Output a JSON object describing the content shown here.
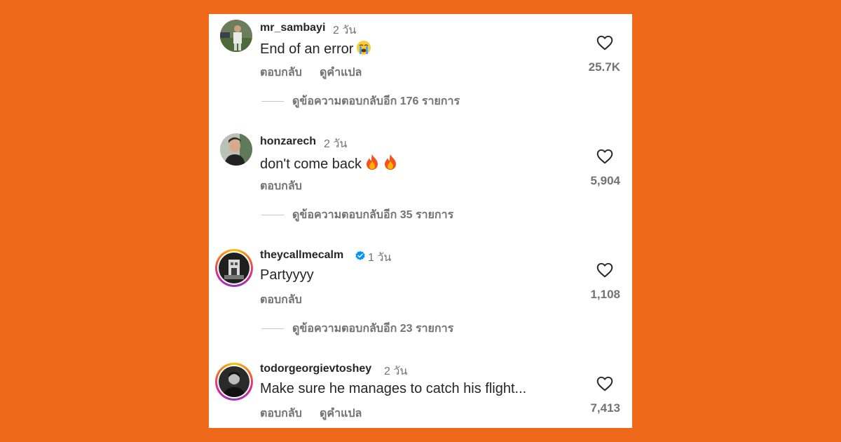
{
  "comments": [
    {
      "username": "mr_sambayi",
      "time": "2 วัน",
      "text": "End of an error",
      "emoji": "crying-face",
      "reply_label": "ตอบกลับ",
      "translate_label": "ดูคำแปล",
      "likes": "25.7K",
      "view_replies": "ดูข้อความตอบกลับอีก 176 รายการ"
    },
    {
      "username": "honzarech",
      "time": "2 วัน",
      "text": "don't come back",
      "emoji": "fire x2",
      "reply_label": "ตอบกลับ",
      "likes": "5,904",
      "view_replies": "ดูข้อความตอบกลับอีก 35 รายการ"
    },
    {
      "username": "theycallmecalm",
      "verified": true,
      "time": "1 วัน",
      "text": "Partyyyy",
      "reply_label": "ตอบกลับ",
      "likes": "1,108",
      "view_replies": "ดูข้อความตอบกลับอีก 23 รายการ"
    },
    {
      "username": "todorgeorgievtoshey",
      "time": "2 วัน",
      "text": "Make sure he manages to catch his flight...",
      "reply_label": "ตอบกลับ",
      "translate_label": "ดูคำแปล",
      "likes": "7,413"
    }
  ],
  "colors": {
    "background": "#EE6A1A",
    "card": "#FFFFFF",
    "primary_text": "#262626",
    "secondary_text": "#737373",
    "verified": "#0095F6"
  },
  "icons": [
    "heart-outline-icon",
    "verified-badge-icon",
    "crying-face-emoji",
    "fire-emoji"
  ]
}
